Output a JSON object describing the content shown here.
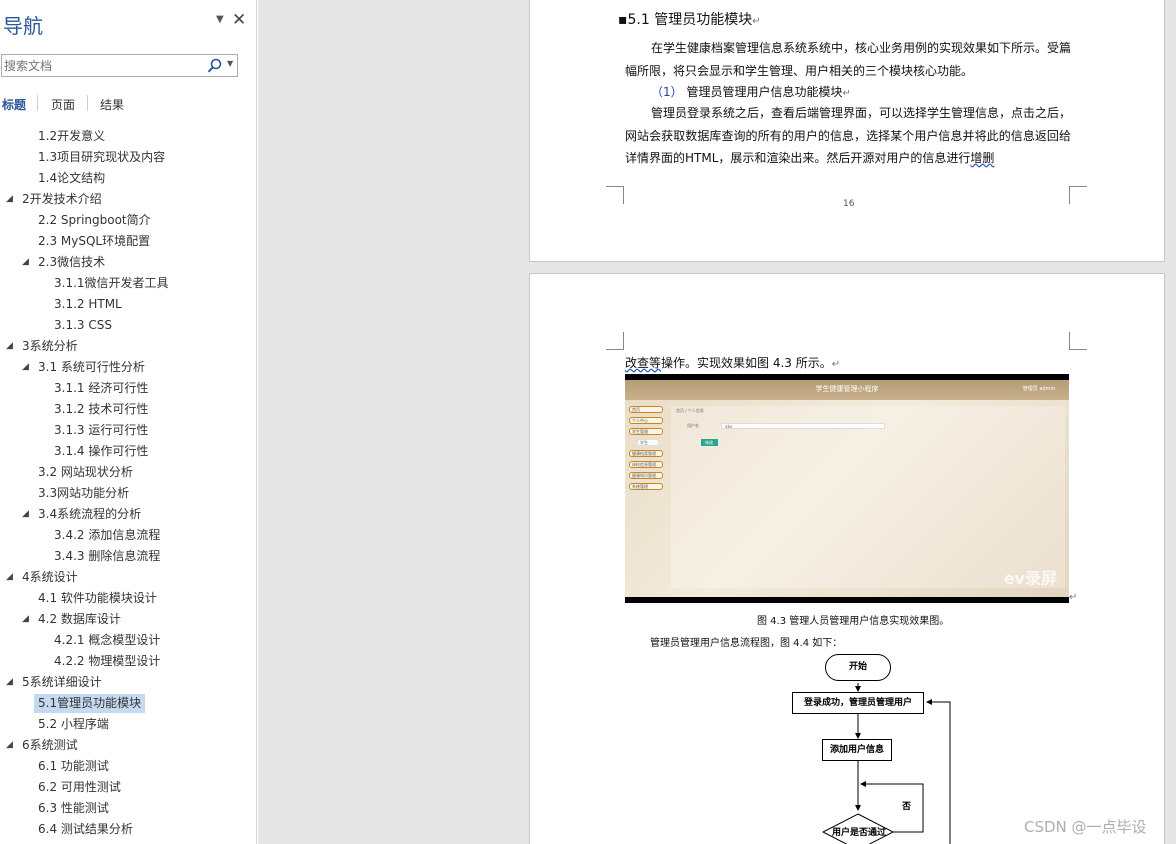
{
  "nav": {
    "title": "导航",
    "menu_glyph": "▼",
    "close_glyph": "✕",
    "search_placeholder": "搜索文档",
    "search_dropdown_glyph": "▼",
    "tabs": [
      "标题",
      "页面",
      "结果"
    ],
    "collapse_glyph": "◢",
    "outline": [
      {
        "text": "1.2开发意义",
        "level": 2,
        "expanded": null,
        "selected": false
      },
      {
        "text": "1.3项目研究现状及内容",
        "level": 2,
        "expanded": null,
        "selected": false
      },
      {
        "text": "1.4论文结构",
        "level": 2,
        "expanded": null,
        "selected": false
      },
      {
        "text": "2开发技术介绍",
        "level": 1,
        "expanded": true,
        "selected": false
      },
      {
        "text": "2.2 Springboot简介",
        "level": 2,
        "expanded": null,
        "selected": false
      },
      {
        "text": "2.3 MySQL环境配置",
        "level": 2,
        "expanded": null,
        "selected": false
      },
      {
        "text": "2.3微信技术",
        "level": 2,
        "expanded": true,
        "selected": false
      },
      {
        "text": "3.1.1微信开发者工具",
        "level": 3,
        "expanded": null,
        "selected": false
      },
      {
        "text": "3.1.2 HTML",
        "level": 3,
        "expanded": null,
        "selected": false
      },
      {
        "text": "3.1.3 CSS",
        "level": 3,
        "expanded": null,
        "selected": false
      },
      {
        "text": "3系统分析",
        "level": 1,
        "expanded": true,
        "selected": false
      },
      {
        "text": "3.1 系统可行性分析",
        "level": 2,
        "expanded": true,
        "selected": false
      },
      {
        "text": "3.1.1 经济可行性",
        "level": 3,
        "expanded": null,
        "selected": false
      },
      {
        "text": "3.1.2 技术可行性",
        "level": 3,
        "expanded": null,
        "selected": false
      },
      {
        "text": "3.1.3 运行可行性",
        "level": 3,
        "expanded": null,
        "selected": false
      },
      {
        "text": "3.1.4 操作可行性",
        "level": 3,
        "expanded": null,
        "selected": false
      },
      {
        "text": "3.2 网站现状分析",
        "level": 2,
        "expanded": null,
        "selected": false
      },
      {
        "text": "3.3网站功能分析",
        "level": 2,
        "expanded": null,
        "selected": false
      },
      {
        "text": "3.4系统流程的分析",
        "level": 2,
        "expanded": true,
        "selected": false
      },
      {
        "text": "3.4.2 添加信息流程",
        "level": 3,
        "expanded": null,
        "selected": false
      },
      {
        "text": "3.4.3 删除信息流程",
        "level": 3,
        "expanded": null,
        "selected": false
      },
      {
        "text": "4系统设计",
        "level": 1,
        "expanded": true,
        "selected": false
      },
      {
        "text": "4.1 软件功能模块设计",
        "level": 2,
        "expanded": null,
        "selected": false
      },
      {
        "text": "4.2 数据库设计",
        "level": 2,
        "expanded": true,
        "selected": false
      },
      {
        "text": "4.2.1 概念模型设计",
        "level": 3,
        "expanded": null,
        "selected": false
      },
      {
        "text": "4.2.2 物理模型设计",
        "level": 3,
        "expanded": null,
        "selected": false
      },
      {
        "text": "5系统详细设计",
        "level": 1,
        "expanded": true,
        "selected": false
      },
      {
        "text": "5.1管理员功能模块",
        "level": 2,
        "expanded": null,
        "selected": true
      },
      {
        "text": "5.2 小程序端",
        "level": 2,
        "expanded": null,
        "selected": false
      },
      {
        "text": "6系统测试",
        "level": 1,
        "expanded": true,
        "selected": false
      },
      {
        "text": "6.1 功能测试",
        "level": 2,
        "expanded": null,
        "selected": false
      },
      {
        "text": "6.2 可用性测试",
        "level": 2,
        "expanded": null,
        "selected": false
      },
      {
        "text": "6.3 性能测试",
        "level": 2,
        "expanded": null,
        "selected": false
      },
      {
        "text": "6.4 测试结果分析",
        "level": 2,
        "expanded": null,
        "selected": false
      }
    ]
  },
  "page16": {
    "heading": "5.1 管理员功能模块",
    "bullet": "▪",
    "para_mark": "↵",
    "p1": "在学生健康档案管理信息系统系统中，核心业务用例的实现效果如下所示。受篇幅所限，将只会显示和学生管理、用户相关的三个模块核心功能。",
    "sub_num": "（1）",
    "sub_title": "管理员管理用户信息功能模块",
    "p2": "管理员登录系统之后，查看后端管理界面，可以选择学生管理信息，点击之后，网站会获取数据库查询的所有的用户的信息，选择某个用户信息并将此的信息返回给详情界面的HTML，展示和渲染出来。然后开源对用户的信息进行",
    "p2_tail": "增删",
    "page_number": "16"
  },
  "page17": {
    "cont_head": "改查等",
    "cont_rest": "操作。实现效果如图 4.3 所示。",
    "screenshot": {
      "app_title": "学生健康管理小程序",
      "user_text": "管理员 admin",
      "menu": [
        "首页",
        "个人中心",
        "学生管理",
        "学生",
        "健康档案管理",
        "体检信息管理",
        "健康知识管理",
        "系统管理"
      ],
      "breadcrumb": "首页 / 个人信息",
      "field_label": "用户名",
      "field_value": "abo",
      "button": "修改",
      "watermark": "ev录屏"
    },
    "caption": "图 4.3  管理人员管理用户信息实现效果图。",
    "flow_intro": "管理员管理用户信息流程图，图 4.4 如下：",
    "flow": {
      "start": "开始",
      "step1": "登录成功，管理员管理用户",
      "step2": "添加用户信息",
      "decision": "用户是否通过",
      "no": "否"
    }
  },
  "watermark": "CSDN @一点毕设"
}
